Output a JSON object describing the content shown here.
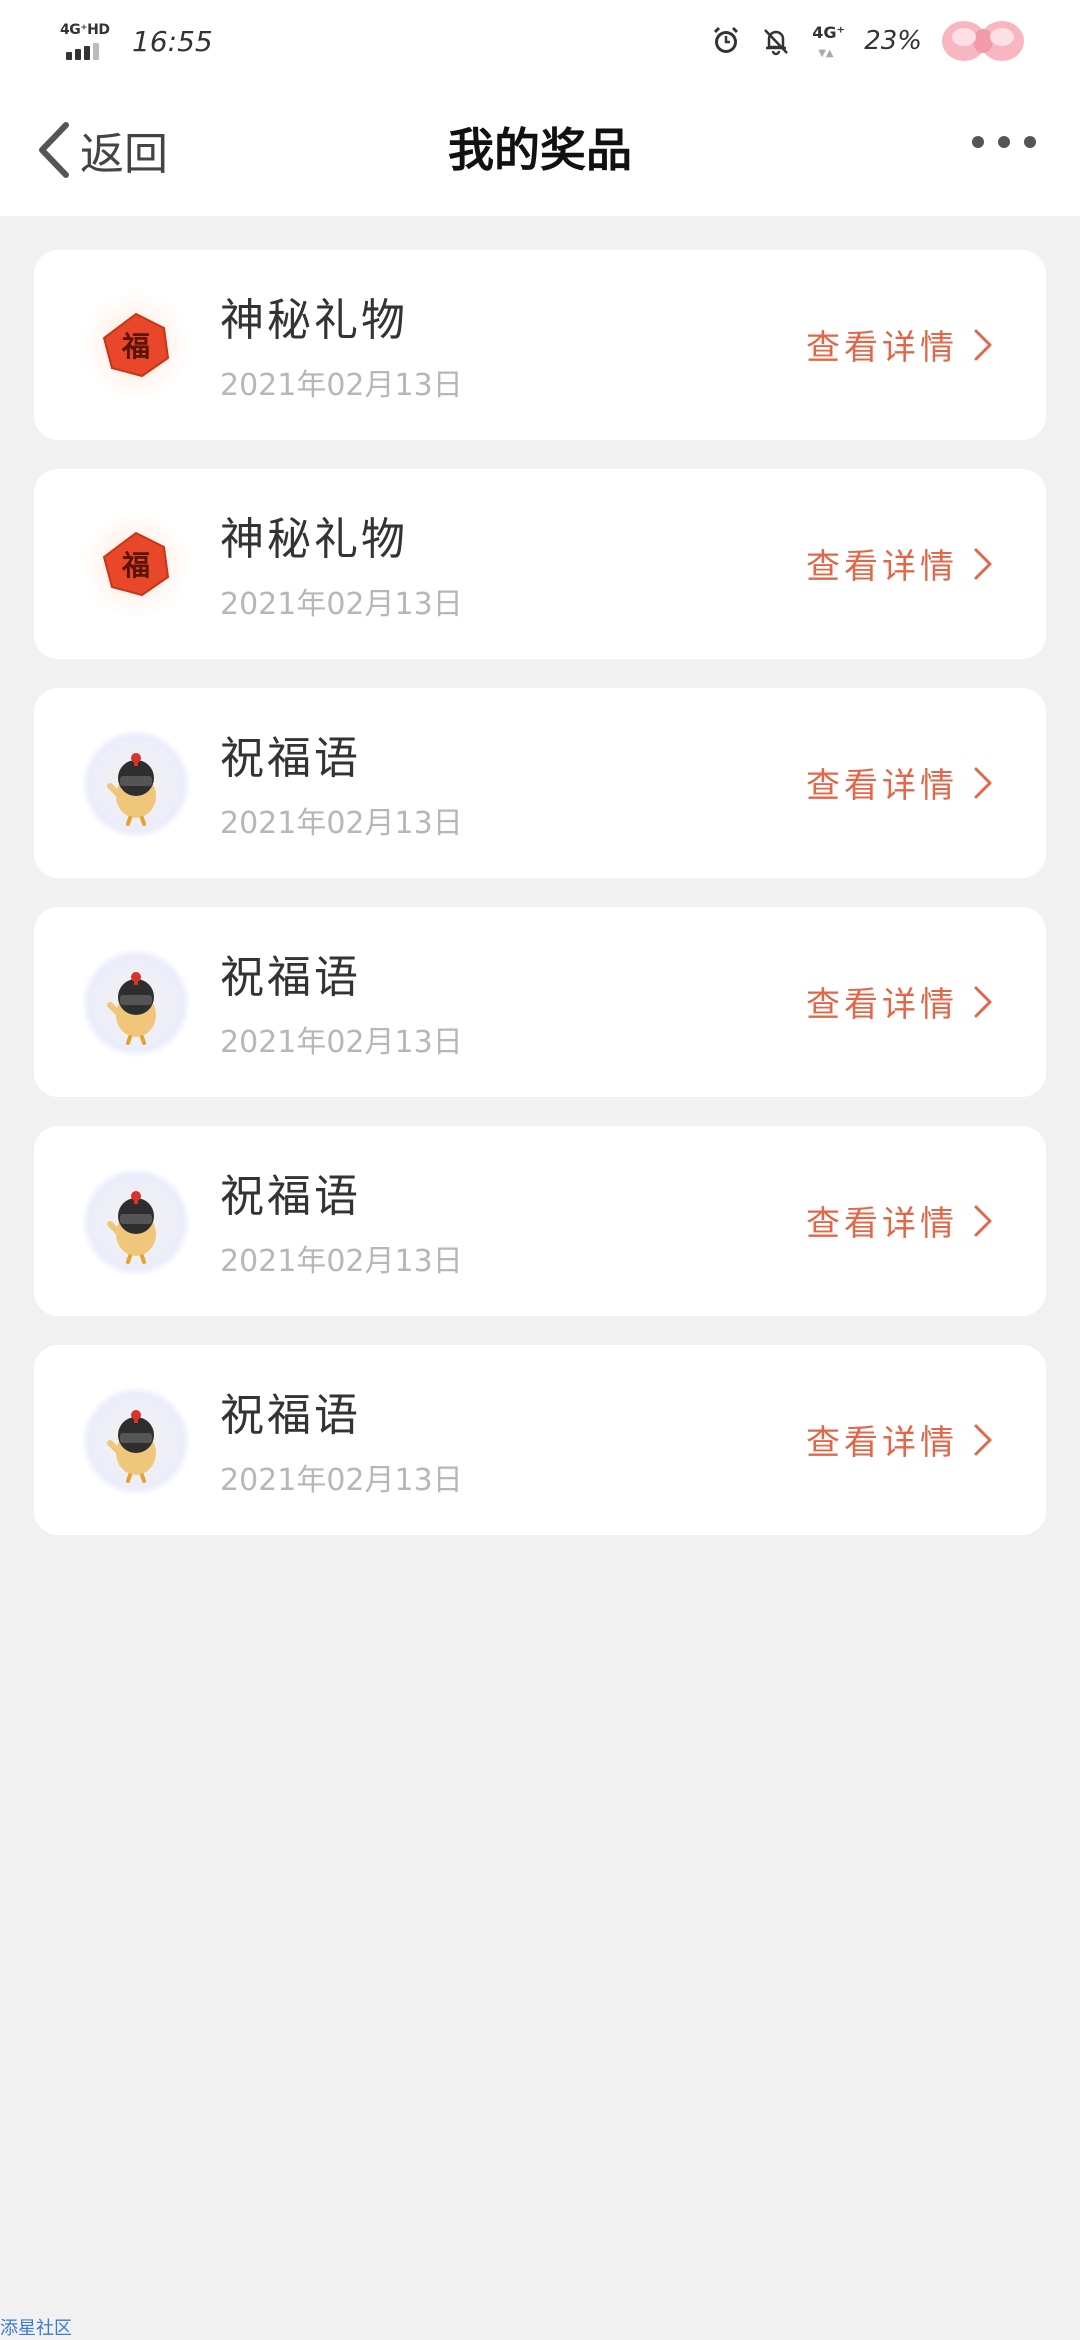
{
  "status_bar": {
    "network": "4G⁺HD",
    "time": "16:55",
    "network_right": "4G⁺",
    "battery": "23%",
    "icons": [
      "signal-icon",
      "alarm-icon",
      "bell-off-icon",
      "network-icon",
      "bow-icon"
    ]
  },
  "header": {
    "back_label": "返回",
    "title": "我的奖品",
    "more_icon": "more-dots-icon"
  },
  "prizes": [
    {
      "title": "神秘礼物",
      "date": "2021年02月13日",
      "action": "查看详情",
      "icon": "fu-badge-icon"
    },
    {
      "title": "神秘礼物",
      "date": "2021年02月13日",
      "action": "查看详情",
      "icon": "fu-badge-icon"
    },
    {
      "title": "祝福语",
      "date": "2021年02月13日",
      "action": "查看详情",
      "icon": "chick-warrior-icon"
    },
    {
      "title": "祝福语",
      "date": "2021年02月13日",
      "action": "查看详情",
      "icon": "chick-warrior-icon"
    },
    {
      "title": "祝福语",
      "date": "2021年02月13日",
      "action": "查看详情",
      "icon": "chick-warrior-icon"
    },
    {
      "title": "祝福语",
      "date": "2021年02月13日",
      "action": "查看详情",
      "icon": "chick-warrior-icon"
    }
  ],
  "colors": {
    "accent": "#e2674a",
    "background": "#f1f1f1",
    "card": "#ffffff",
    "date_text": "#b7b7b7"
  },
  "watermark": "添星社区"
}
